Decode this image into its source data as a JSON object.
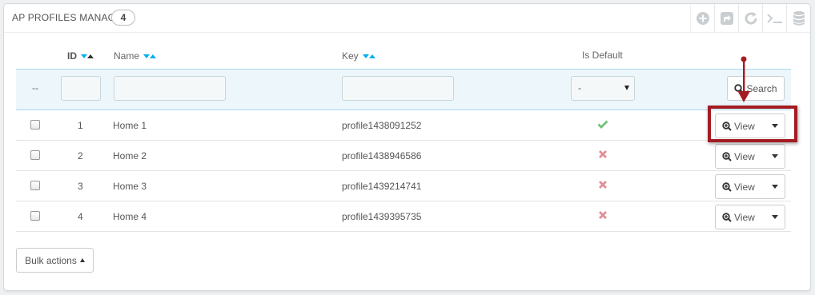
{
  "panel": {
    "title": "AP PROFILES MANAGE",
    "count": "4",
    "toolbar_icons": [
      "add-new-icon",
      "export-icon",
      "refresh-icon",
      "sql-query-icon",
      "sql-manager-icon"
    ]
  },
  "table": {
    "columns": {
      "id": "ID",
      "name": "Name",
      "key": "Key",
      "is_default": "Is Default"
    },
    "filter": {
      "placeholder_dash": "--",
      "default_select_value": "-",
      "search_label": "Search"
    },
    "rows": [
      {
        "id": "1",
        "name": "Home 1",
        "key": "profile1438091252",
        "is_default": true,
        "action": "View"
      },
      {
        "id": "2",
        "name": "Home 2",
        "key": "profile1438946586",
        "is_default": false,
        "action": "View"
      },
      {
        "id": "3",
        "name": "Home 3",
        "key": "profile1439214741",
        "is_default": false,
        "action": "View"
      },
      {
        "id": "4",
        "name": "Home 4",
        "key": "profile1439395735",
        "is_default": false,
        "action": "View"
      }
    ]
  },
  "bulk_actions_label": "Bulk actions",
  "colors": {
    "accent": "#00aff0",
    "check_green": "#72c279",
    "cross_red": "#e08f95",
    "highlight_red": "#a31c22"
  }
}
